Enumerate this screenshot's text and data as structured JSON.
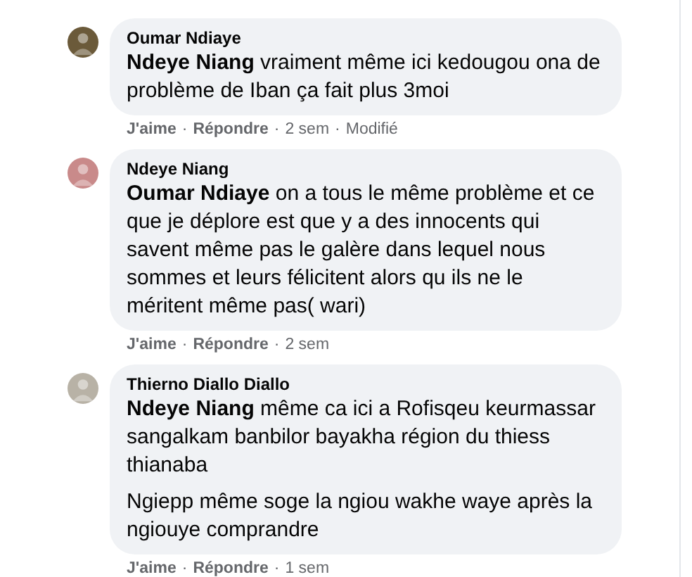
{
  "separator": "·",
  "comments": [
    {
      "author": "Oumar Ndiaye",
      "paragraphs": [
        "**Ndeye Niang** vraiment même ici kedougou ona de problème de Iban ça fait plus 3moi"
      ],
      "actions": {
        "like": "J'aime",
        "reply": "Répondre",
        "time": "2 sem",
        "edited": "Modifié"
      }
    },
    {
      "author": "Ndeye Niang",
      "paragraphs": [
        "**Oumar Ndiaye** on a tous le même problème et ce que je déplore est que y a des innocents qui savent même pas le galère dans lequel nous sommes et leurs félicitent alors qu ils ne le méritent même pas( wari)"
      ],
      "actions": {
        "like": "J'aime",
        "reply": "Répondre",
        "time": "2 sem"
      }
    },
    {
      "author": "Thierno Diallo Diallo",
      "paragraphs": [
        "**Ndeye Niang** même ca ici a Rofisqeu keurmassar sangalkam banbilor bayakha région du thiess thianaba",
        "Ngiepp même soge la ngiou wakhe waye après la ngiouye comprandre"
      ],
      "actions": {
        "like": "J'aime",
        "reply": "Répondre",
        "time": "1 sem"
      }
    }
  ]
}
